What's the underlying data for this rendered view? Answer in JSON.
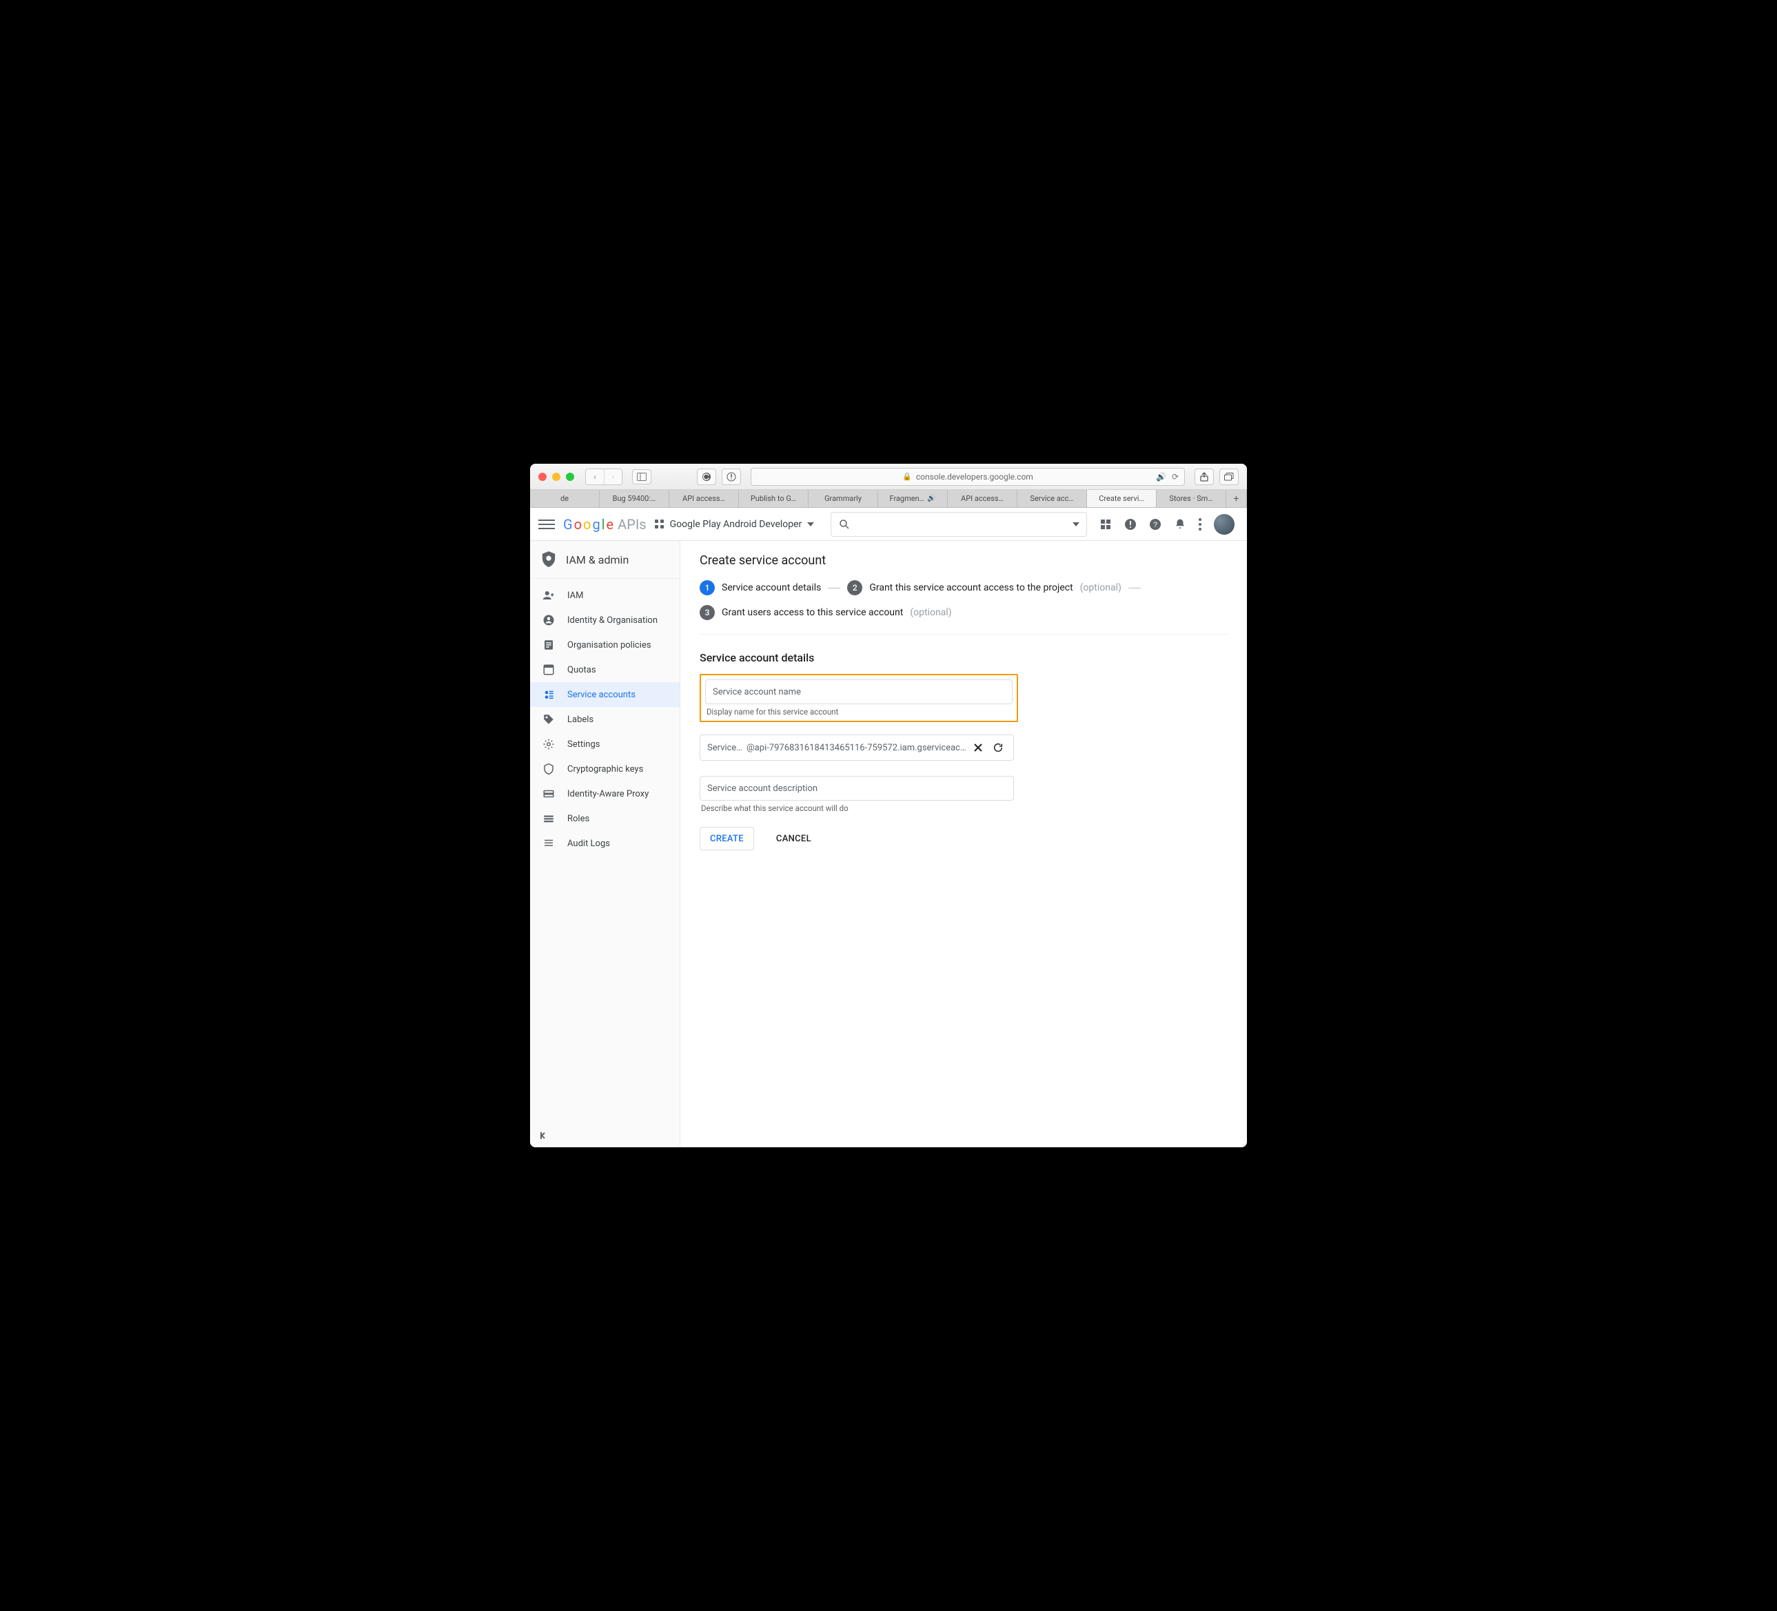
{
  "browser": {
    "url_host": "console.developers.google.com",
    "tabs": [
      {
        "label": "de",
        "active": false
      },
      {
        "label": "Bug 59400:…",
        "active": false
      },
      {
        "label": "API access…",
        "active": false
      },
      {
        "label": "Publish to G…",
        "active": false
      },
      {
        "label": "Grammarly",
        "active": false
      },
      {
        "label": "Fragmen…",
        "active": false,
        "sound": true
      },
      {
        "label": "API access…",
        "active": false
      },
      {
        "label": "Service acc…",
        "active": false
      },
      {
        "label": "Create servi…",
        "active": true
      },
      {
        "label": "Stores · Sm…",
        "active": false
      }
    ]
  },
  "header": {
    "logo_brand": "Google",
    "logo_suffix": "APIs",
    "project_name": "Google Play Android Developer"
  },
  "sidebar": {
    "title": "IAM & admin",
    "items": [
      {
        "icon": "person-add",
        "label": "IAM"
      },
      {
        "icon": "account",
        "label": "Identity & Organisation"
      },
      {
        "icon": "doc",
        "label": "Organisation policies"
      },
      {
        "icon": "quota",
        "label": "Quotas"
      },
      {
        "icon": "service",
        "label": "Service accounts",
        "active": true
      },
      {
        "icon": "tag",
        "label": "Labels"
      },
      {
        "icon": "gear",
        "label": "Settings"
      },
      {
        "icon": "key",
        "label": "Cryptographic keys"
      },
      {
        "icon": "iap",
        "label": "Identity-Aware Proxy"
      },
      {
        "icon": "roles",
        "label": "Roles"
      },
      {
        "icon": "logs",
        "label": "Audit Logs"
      }
    ]
  },
  "main": {
    "page_title": "Create service account",
    "steps": {
      "s1": {
        "num": "1",
        "label": "Service account details"
      },
      "s2": {
        "num": "2",
        "label": "Grant this service account access to the project",
        "optional": "(optional)"
      },
      "s3": {
        "num": "3",
        "label": "Grant users access to this service account",
        "optional": "(optional)"
      }
    },
    "section_title": "Service account details",
    "name_field": {
      "placeholder": "Service account name",
      "helper": "Display name for this service account"
    },
    "id_field": {
      "prefix": "Service…",
      "email": "@api-7976831618413465116-759572.iam.gserviceaccount.com"
    },
    "desc_field": {
      "placeholder": "Service account description",
      "helper": "Describe what this service account will do"
    },
    "buttons": {
      "create": "CREATE",
      "cancel": "CANCEL"
    }
  }
}
